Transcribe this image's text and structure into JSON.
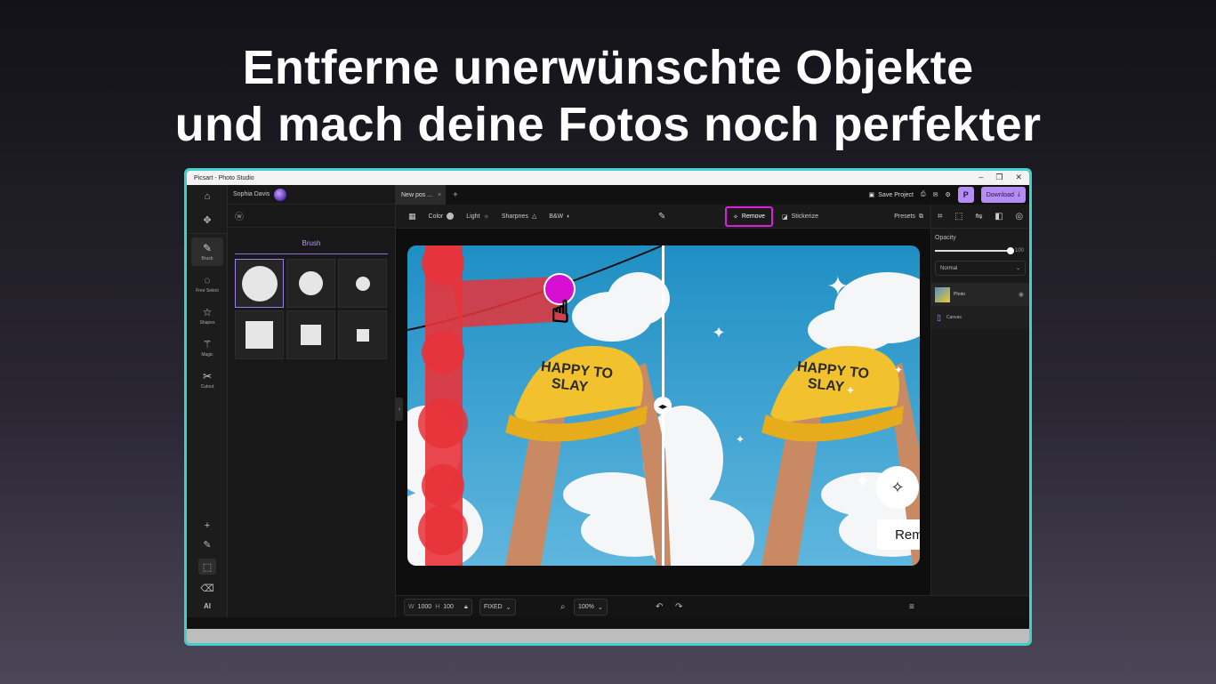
{
  "headline": {
    "line1": "Entferne unerwünschte Objekte",
    "line2": "und mach deine Fotos noch perfekter"
  },
  "window": {
    "title": "Picsart - Photo Studio",
    "controls": [
      "–",
      "❐",
      "✕"
    ]
  },
  "left_rail": {
    "top": [
      {
        "icon": "home-icon",
        "glyph": "⌂"
      },
      {
        "icon": "move-icon",
        "glyph": "✥"
      }
    ],
    "tools": [
      {
        "icon": "brush-icon",
        "glyph": "✎",
        "label": "Brush",
        "active": true
      },
      {
        "icon": "free-select-icon",
        "glyph": "◌",
        "label": "Free Select"
      },
      {
        "icon": "shapes-icon",
        "glyph": "☆",
        "label": "Shapes"
      },
      {
        "icon": "magic-icon",
        "glyph": "⚚",
        "label": "Magic"
      },
      {
        "icon": "cutout-icon",
        "glyph": "✂",
        "label": "Cutout"
      }
    ],
    "bottom": [
      {
        "icon": "add-icon",
        "glyph": "+"
      },
      {
        "icon": "brush-small-icon",
        "glyph": "✎"
      },
      {
        "icon": "selection-icon",
        "glyph": "⬚"
      },
      {
        "icon": "eraser-icon",
        "glyph": "⌫"
      },
      {
        "icon": "ai-icon",
        "glyph": "AI"
      }
    ]
  },
  "left_panel": {
    "user": "Sophia Davis",
    "sub_icon": "ⓦ",
    "tab": "Brush"
  },
  "top_bar": {
    "doc_tab": "New pos ...",
    "doc_close": "×",
    "new_tab": "+",
    "save": "Save Project",
    "p_badge": "P",
    "download": "Download"
  },
  "toolbar": {
    "color": "Color",
    "light": "Light",
    "sharpness": "Sharpnes",
    "bw": "B&W",
    "remove": "Remove",
    "stickerize": "Stickerize",
    "presets": "Presets"
  },
  "photo": {
    "cap_text_1": "HAPPY TO",
    "cap_text_2": "SLAY",
    "remove_badge": "Remove"
  },
  "bottom_bar": {
    "w_label": "W",
    "w_value": "1000",
    "h_label": "H",
    "h_value": "100",
    "mode": "FIXED",
    "zoom": "100%"
  },
  "right_panel": {
    "opacity_label": "Opacity",
    "opacity_value": "100",
    "opacity_fraction": 1.0,
    "blend": "Normal",
    "layers": [
      "Photo",
      "Canvas"
    ]
  },
  "colors": {
    "accent": "#b48df2",
    "highlight": "#d91ee0",
    "frame": "#3fd0c9",
    "brush_stroke": "#e8333a"
  }
}
